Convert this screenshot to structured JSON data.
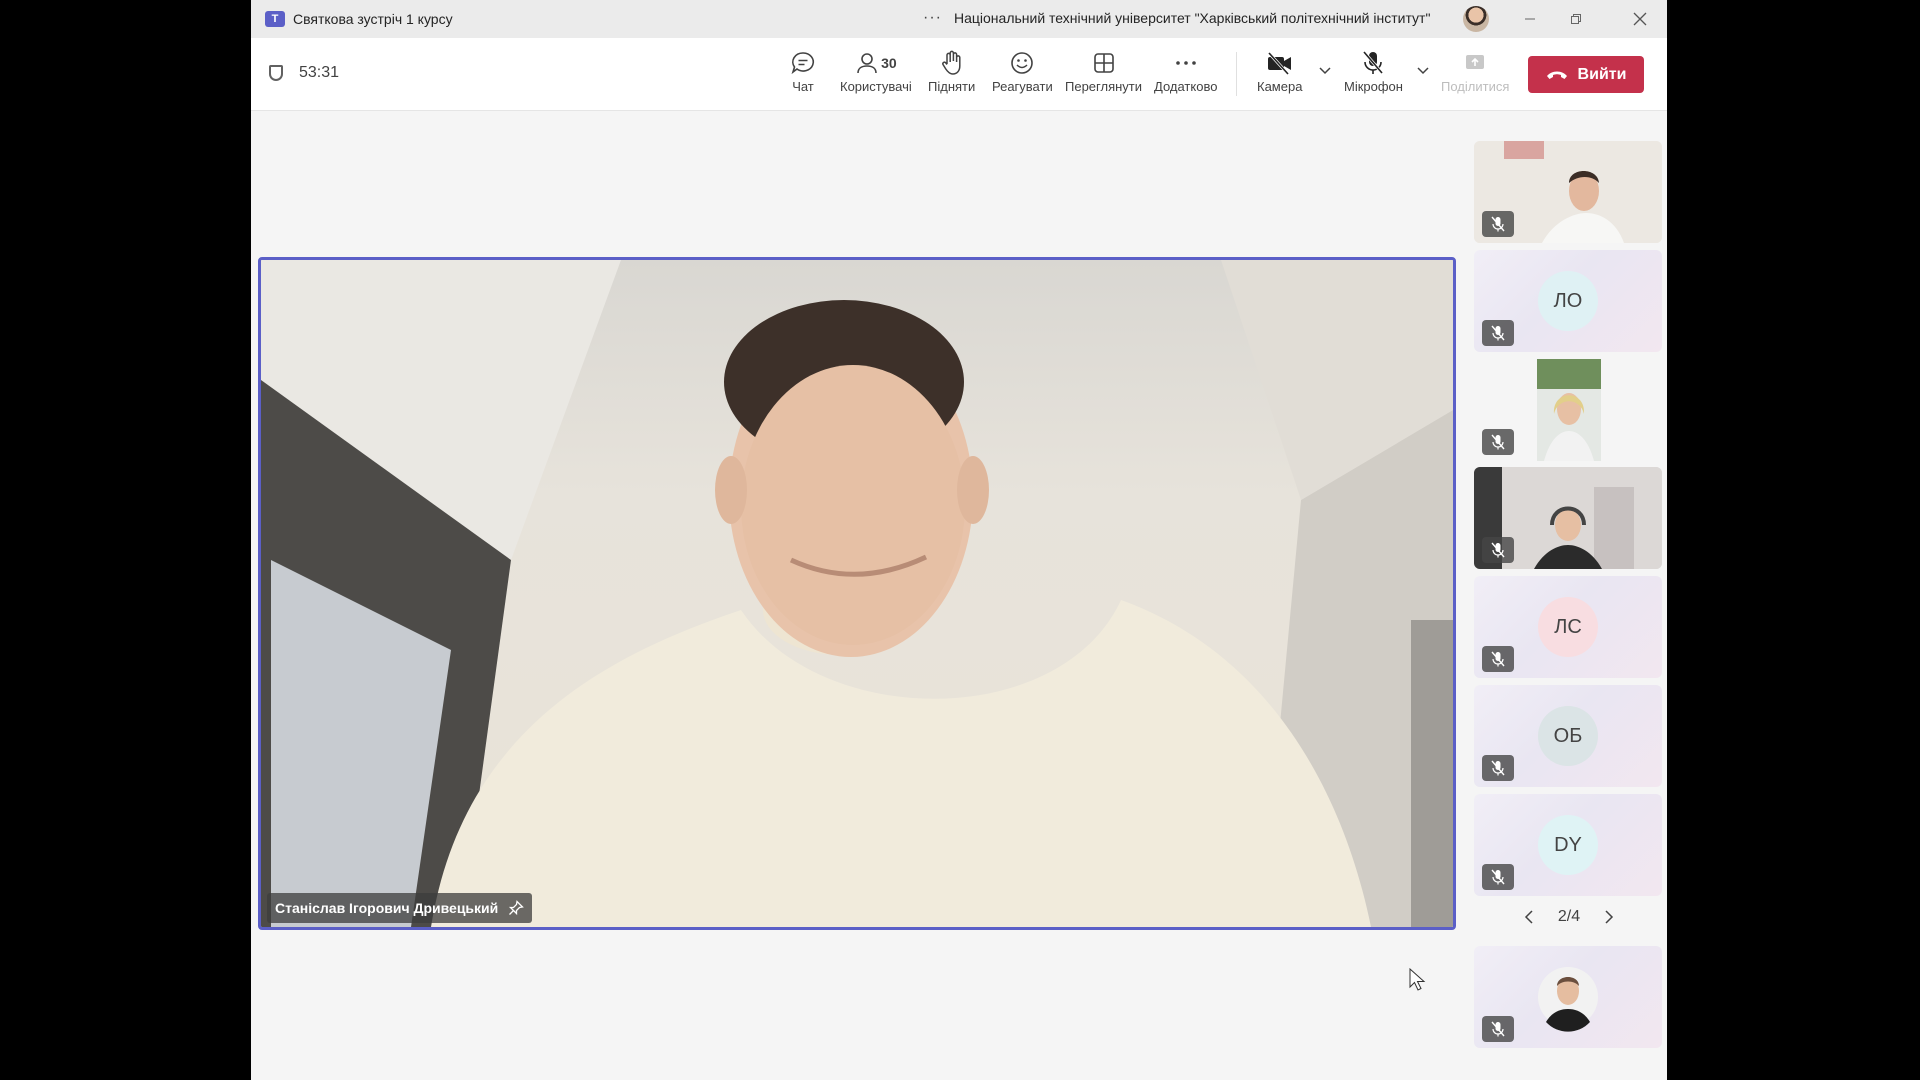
{
  "window": {
    "title": "Святкова зустріч 1 курсу",
    "organization": "Національний технічний університет \"Харківський політехнічний інститут\"",
    "more_label": "···"
  },
  "toolbar": {
    "timer": "53:31",
    "participants_count": "30",
    "buttons": [
      {
        "label": "Чат",
        "icon": "chat-icon"
      },
      {
        "label": "Користувачі",
        "icon": "people-icon"
      },
      {
        "label": "Підняти",
        "icon": "raise-hand-icon"
      },
      {
        "label": "Реагувати",
        "icon": "react-icon"
      },
      {
        "label": "Переглянути",
        "icon": "view-icon"
      },
      {
        "label": "Додатково",
        "icon": "more-icon"
      },
      {
        "label": "Камера",
        "icon": "camera-off-icon"
      },
      {
        "label": "Мікрофон",
        "icon": "mic-off-icon"
      },
      {
        "label": "Поділитися",
        "icon": "share-icon"
      }
    ],
    "leave_label": "Вийти"
  },
  "stage": {
    "speaker_name": "Станіслав Ігорович Дривецький"
  },
  "gallery": {
    "tiles": [
      {
        "type": "video"
      },
      {
        "type": "initials",
        "initials": "ЛО",
        "color": "#dff1f4"
      },
      {
        "type": "video"
      },
      {
        "type": "video"
      },
      {
        "type": "initials",
        "initials": "ЛС",
        "color": "#f8dde1"
      },
      {
        "type": "initials",
        "initials": "ОБ",
        "color": "#dbe4e6"
      },
      {
        "type": "initials",
        "initials": "DY",
        "color": "#dff3f5"
      },
      {
        "type": "avatar"
      }
    ],
    "page_label": "2/4"
  },
  "colors": {
    "accent": "#5b5fc7",
    "leave": "#c4314b"
  }
}
